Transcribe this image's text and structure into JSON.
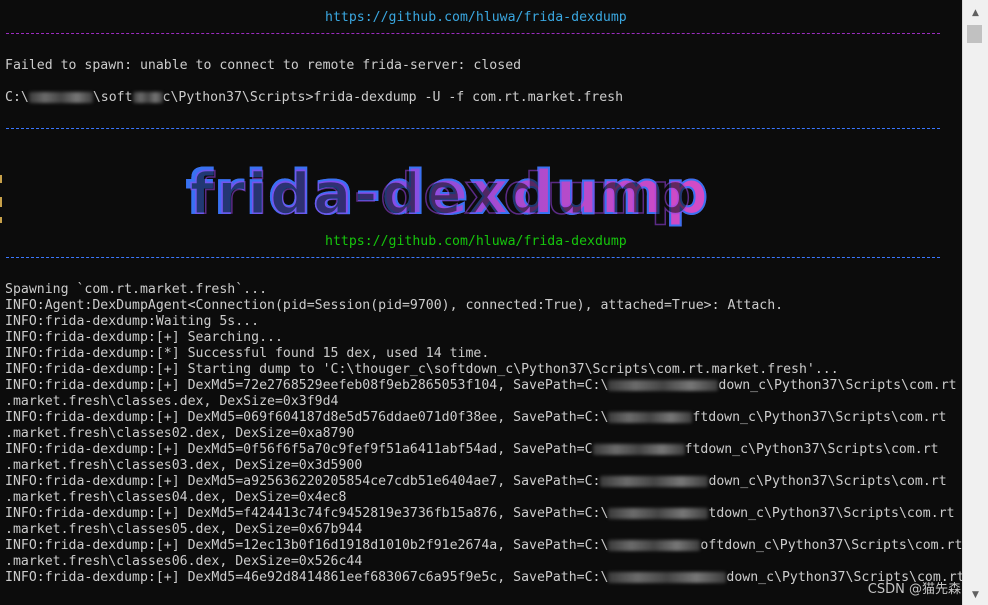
{
  "terminal": {
    "url_top": "https://github.com/hluwa/frida-dexdump",
    "error_line": "Failed to spawn: unable to connect to remote frida-server: closed",
    "prompt": {
      "prefix": "C:\\",
      "mid": "\\soft",
      "suffix": "c\\Python37\\Scripts>frida-dexdump -U -f com.rt.market.fresh"
    },
    "banner_text": "frida-dexdump",
    "url_bottom": "https://github.com/hluwa/frida-dexdump",
    "lines": [
      "Spawning `com.rt.market.fresh`...",
      "INFO:Agent:DexDumpAgent<Connection(pid=Session(pid=9700), connected:True), attached=True>: Attach.",
      "INFO:frida-dexdump:Waiting 5s...",
      "INFO:frida-dexdump:[+] Searching...",
      "INFO:frida-dexdump:[*] Successful found 15 dex, used 14 time.",
      "INFO:frida-dexdump:[+] Starting dump to 'C:\\thouger_c\\softdown_c\\Python37\\Scripts\\com.rt.market.fresh'..."
    ],
    "dex_entries": [
      {
        "prefix": "INFO:frida-dexdump:[+] DexMd5=72e2768529eefeb08f9eb2865053f104, SavePath=C:\\",
        "tail": "down_c\\Python37\\Scripts\\com.rt",
        "cont": ".market.fresh\\classes.dex, DexSize=0x3f9d4"
      },
      {
        "prefix": "INFO:frida-dexdump:[+] DexMd5=069f604187d8e5d576ddae071d0f38ee, SavePath=C:\\",
        "tail": "ftdown_c\\Python37\\Scripts\\com.rt",
        "cont": ".market.fresh\\classes02.dex, DexSize=0xa8790"
      },
      {
        "prefix": "INFO:frida-dexdump:[+] DexMd5=0f56f6f5a70c9fef9f51a6411abf54ad, SavePath=C",
        "tail": "ftdown_c\\Python37\\Scripts\\com.rt",
        "cont": ".market.fresh\\classes03.dex, DexSize=0x3d5900"
      },
      {
        "prefix": "INFO:frida-dexdump:[+] DexMd5=a925636220205854ce7cdb51e6404ae7, SavePath=C:",
        "tail": "down_c\\Python37\\Scripts\\com.rt",
        "cont": ".market.fresh\\classes04.dex, DexSize=0x4ec8"
      },
      {
        "prefix": "INFO:frida-dexdump:[+] DexMd5=f424413c74fc9452819e3736fb15a876, SavePath=C:\\",
        "tail": "tdown_c\\Python37\\Scripts\\com.rt",
        "cont": ".market.fresh\\classes05.dex, DexSize=0x67b944"
      },
      {
        "prefix": "INFO:frida-dexdump:[+] DexMd5=12ec13b0f16d1918d1010b2f91e2674a, SavePath=C:\\",
        "tail": "oftdown_c\\Python37\\Scripts\\com.rt",
        "cont": ".market.fresh\\classes06.dex, DexSize=0x526c44"
      },
      {
        "prefix": "INFO:frida-dexdump:[+] DexMd5=46e92d8414861eef683067c6a95f9e5c, SavePath=C:\\",
        "tail": "down_c\\Python37\\Scripts\\com.rt",
        "cont": ""
      }
    ]
  },
  "watermark": "CSDN @猫先森",
  "scrollbar": {
    "up_icon": "chevron-up-icon",
    "down_icon": "chevron-down-icon"
  },
  "colors": {
    "background": "#0c0c0c",
    "text": "#cccccc",
    "url_blue": "#3aa7e0",
    "url_green": "#16c60c",
    "divider_magenta": "#9b2cc0",
    "divider_blue": "#3b78ff"
  }
}
